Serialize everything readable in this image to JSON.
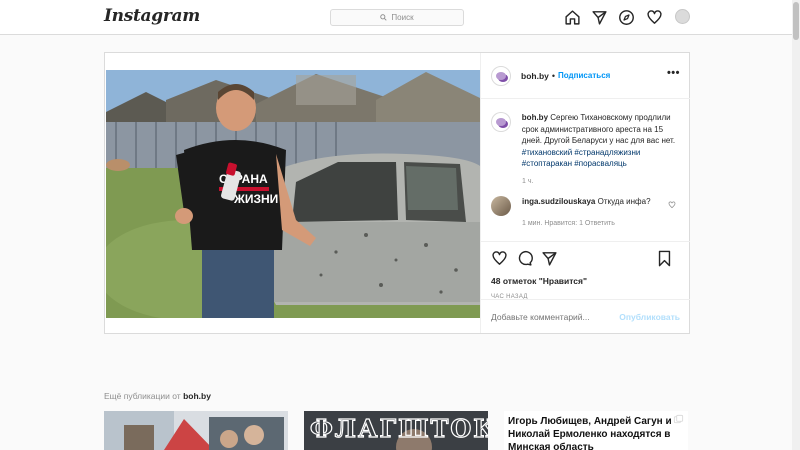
{
  "nav": {
    "logo": "Instagram",
    "search_placeholder": "Поиск"
  },
  "post": {
    "username": "boh.by",
    "follow_label": "Подписаться",
    "more_label": "•••",
    "caption": {
      "username": "boh.by",
      "text": "Сергею Тихановскому продлили срок административного ареста на 15 дней. Другой Беларуси у нас для вас нет.",
      "tags": "#тихановский #странадляжизни #стоптаракан #порасваляць",
      "time": "1 ч."
    },
    "comment": {
      "username": "inga.sudzilouskaya",
      "text": "Откуда инфа?",
      "meta": "1 мин.   Нравится: 1   Ответить"
    },
    "likes": "48 отметок \"Нравится\"",
    "time_ago": "ЧАС НАЗАД",
    "add_comment_placeholder": "Добавьте комментарий...",
    "publish_label": "Опубликовать",
    "shirt_text_1": "СТРАНА",
    "shirt_text_2": "ЖИЗНИ"
  },
  "more_from": {
    "prefix": "Ещё публикации от",
    "username": "boh.by"
  },
  "thumbs": {
    "t2_title": "ФЛАГШТОК",
    "t3_text": "Игорь Любищев, Андрей Сагун и Николай Ермоленко находятся в Минская область"
  }
}
